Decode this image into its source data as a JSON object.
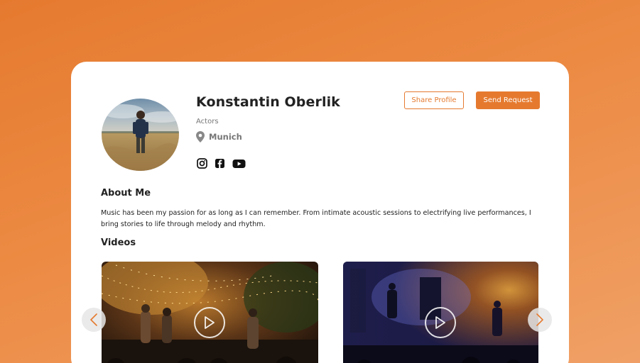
{
  "profile": {
    "name": "Konstantin Oberlik",
    "category": "Actors",
    "location": "Munich",
    "socials": [
      "instagram-icon",
      "facebook-icon",
      "youtube-icon"
    ]
  },
  "actions": {
    "share_label": "Share Profile",
    "request_label": "Send Request"
  },
  "about": {
    "title": "About Me",
    "text": "Music has been my passion for as long as I can remember. From intimate acoustic sessions to electrifying live performances, I bring stories to life through melody and rhythm."
  },
  "videos": {
    "title": "Videos",
    "items": [
      {
        "thumbnail": "outdoor-concert-string-lights"
      },
      {
        "thumbnail": "stage-concert-blue-lights"
      }
    ]
  },
  "colors": {
    "accent": "#e57a2f",
    "background_top": "#e57a2f",
    "background_bottom": "#f0a066"
  }
}
